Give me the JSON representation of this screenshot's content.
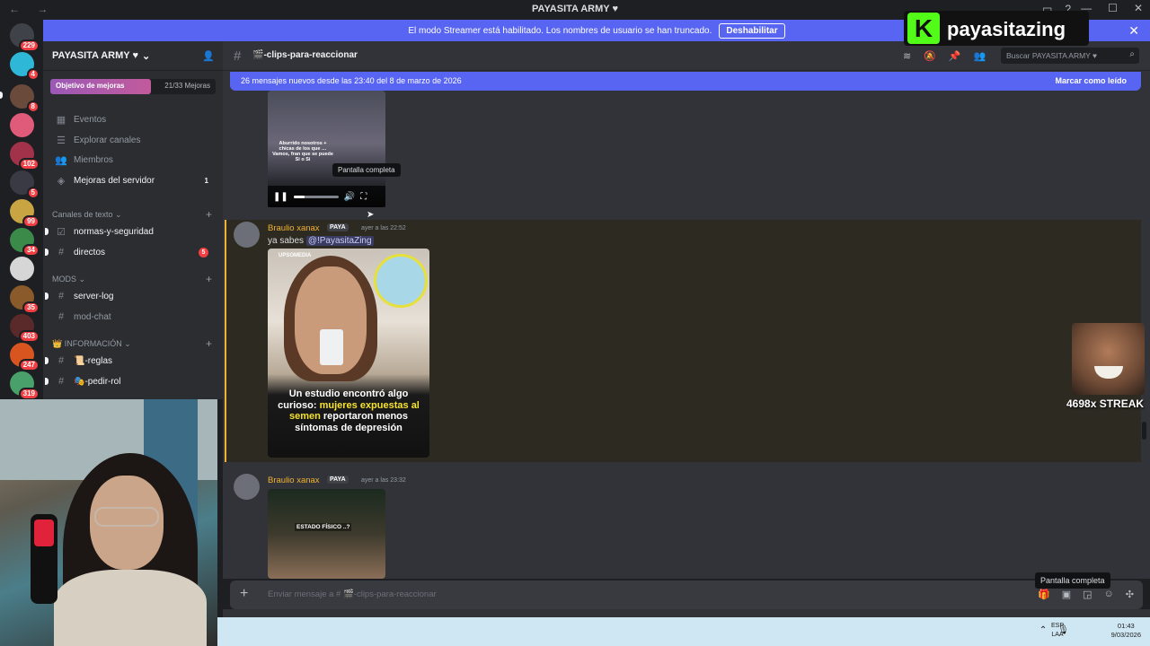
{
  "window": {
    "title": "PAYASITA ARMY ♥",
    "nav": "← →",
    "controls": [
      "—",
      "☐",
      "✕"
    ]
  },
  "rail": {
    "badges": [
      "229",
      "4",
      "8",
      "102",
      "5",
      "99",
      "34",
      "35",
      "403",
      "247",
      "319"
    ]
  },
  "banner": {
    "text": "El modo Streamer está habilitado. Los nombres de usuario se han truncado.",
    "button": "Deshabilitar",
    "close": "✕"
  },
  "server": {
    "name": "PAYASITA ARMY ♥",
    "chevron": "⌄"
  },
  "goal": {
    "label": "Objetivo de mejoras",
    "count": "21/33 Mejoras"
  },
  "sidebar": {
    "items": [
      {
        "icon": "calendar-icon",
        "label": "Eventos"
      },
      {
        "icon": "compass-icon",
        "label": "Explorar canales"
      },
      {
        "icon": "members-icon",
        "label": "Miembros"
      },
      {
        "icon": "boost-icon",
        "label": "Mejoras del servidor",
        "count": "1"
      }
    ],
    "categories": {
      "text": "Canales de texto",
      "mods": "MODS",
      "info": "INFORMACIÓN"
    },
    "channels": [
      {
        "name": "normas-y-seguridad"
      },
      {
        "name": "directos",
        "badge": "5"
      },
      {
        "name": "server-log"
      },
      {
        "name": "mod-chat"
      },
      {
        "name": "📜-reglas"
      },
      {
        "name": "🎭-pedir-rol"
      }
    ]
  },
  "header": {
    "channel": "🎬-clips-para-reaccionar",
    "search_placeholder": "Buscar PAYASITA ARMY ♥"
  },
  "newbar": {
    "text": "26 mensajes nuevos desde las 23:40 del 8 de marzo de 2026",
    "mark": "Marcar como leído"
  },
  "video": {
    "caption": "Aburrido nosotros + chicas de los que … Vamos, fran que se puede Si o Si",
    "tooltip": "Pantalla completa"
  },
  "messages": [
    {
      "author": "Braulio xanax",
      "tag": "PAYA",
      "time": "ayer a las 22:52",
      "text": "ya sabes",
      "mention": "@!PayasitaZing",
      "image": {
        "brand": "UPSOMEDIA",
        "headline_a": "Un estudio encontró algo curioso:",
        "headline_b": "mujeres expuestas al semen",
        "headline_c": "reportaron menos síntomas de depresión"
      }
    },
    {
      "author": "Braulio xanax",
      "tag": "PAYA",
      "time": "ayer a las 23:32",
      "image": {
        "label": "ESTADO FÍSICO ..?"
      }
    }
  ],
  "composer": {
    "placeholder": "Enviar mensaje a # 🎬-clips-para-reaccionar",
    "tooltip": "Pantalla completa"
  },
  "overlay": {
    "brand": "payasitazing",
    "streak": "4698x STREAK"
  },
  "taskbar": {
    "lang_a": "ESP",
    "lang_b": "LAA",
    "time": "01:43",
    "date": "9/03/2026"
  },
  "colors": {
    "accent": "#5865f2",
    "mention_author": "#f0b232",
    "kick_green": "#53fc18"
  }
}
